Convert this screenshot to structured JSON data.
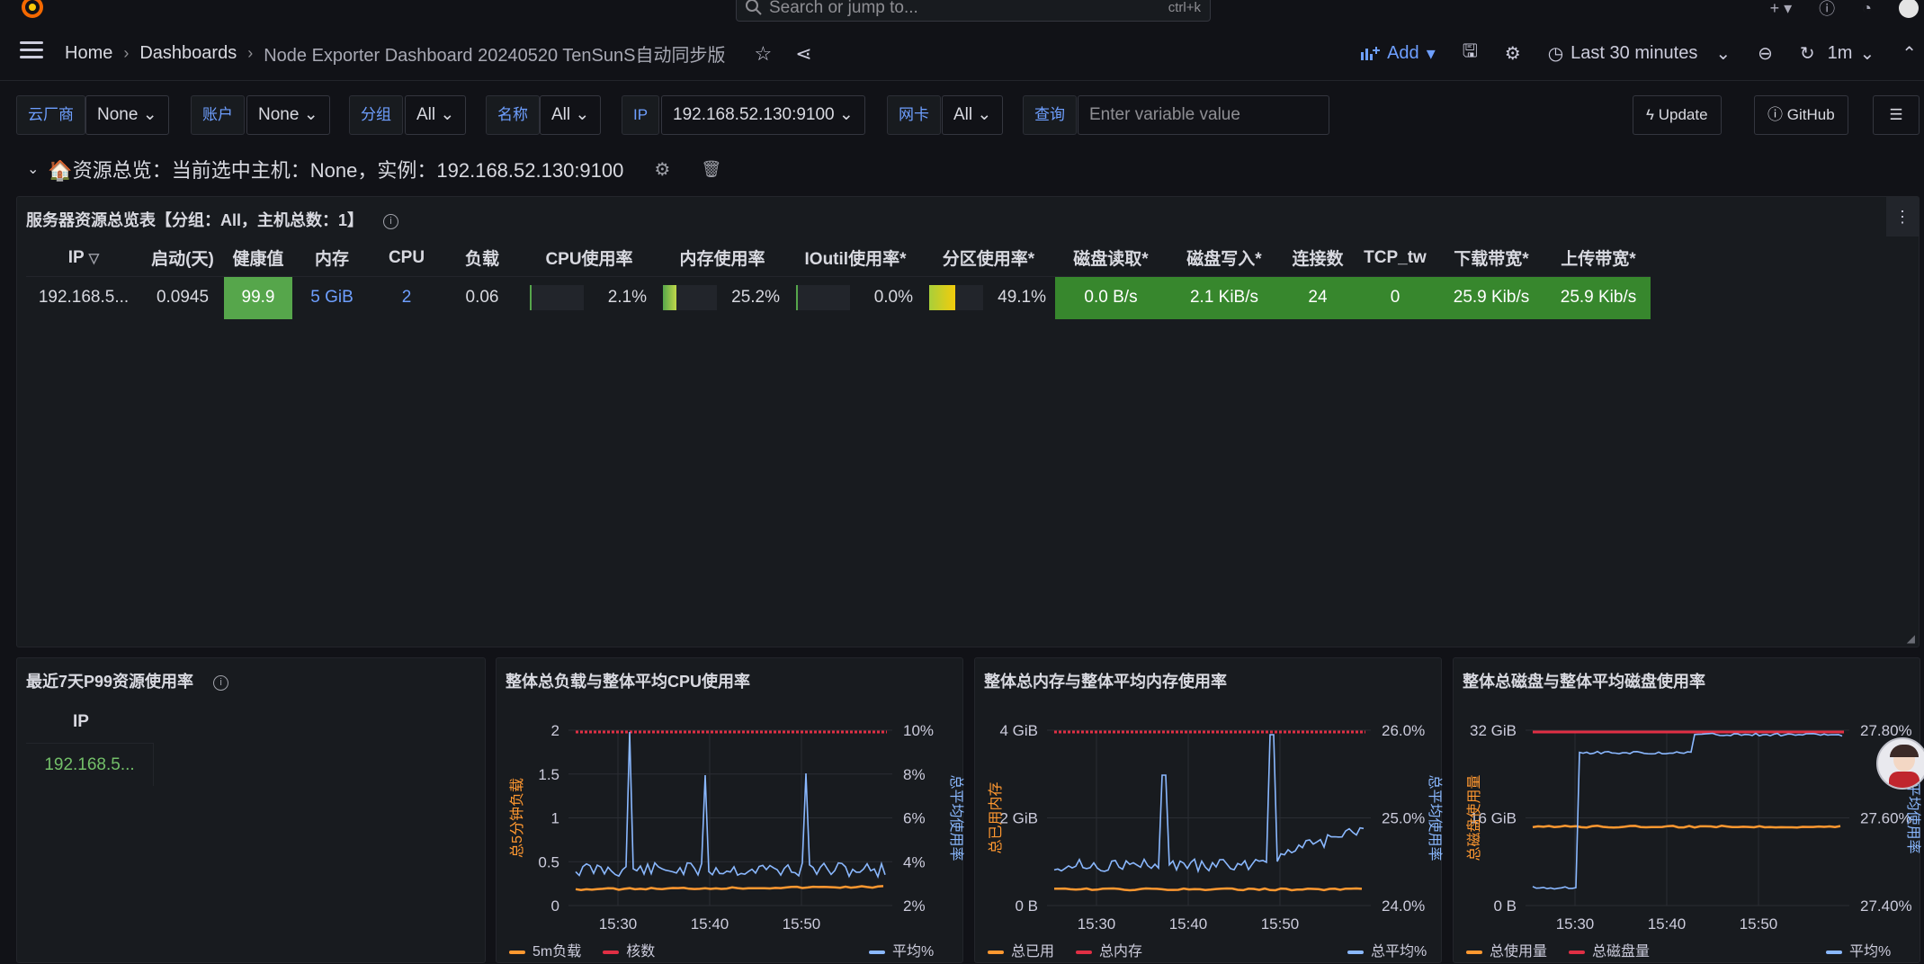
{
  "search": {
    "placeholder": "Search or jump to...",
    "shortcut": "ctrl+k"
  },
  "breadcrumb": {
    "home": "Home",
    "dashboards": "Dashboards",
    "current": "Node Exporter Dashboard 20240520 TenSunS自动同步版"
  },
  "nav": {
    "add": "Add",
    "time_range": "Last 30 minutes",
    "refresh": "1m"
  },
  "variables": [
    {
      "label": "云厂商",
      "value": "None"
    },
    {
      "label": "账户",
      "value": "None"
    },
    {
      "label": "分组",
      "value": "All"
    },
    {
      "label": "名称",
      "value": "All"
    },
    {
      "label": "IP",
      "value": "192.168.52.130:9100"
    },
    {
      "label": "网卡",
      "value": "All"
    },
    {
      "label": "查询",
      "placeholder": "Enter variable value"
    }
  ],
  "buttons": {
    "update": "Update",
    "github": "GitHub"
  },
  "row": {
    "title": "🏠资源总览：当前选中主机：None，实例：192.168.52.130:9100"
  },
  "overview_panel": {
    "title": "服务器资源总览表【分组：All，主机总数：1】",
    "headers": [
      "IP",
      "启动(天)",
      "健康值",
      "内存",
      "CPU",
      "负载",
      "CPU使用率",
      "内存使用率",
      "IOutil使用率*",
      "分区使用率*",
      "磁盘读取*",
      "磁盘写入*",
      "连接数",
      "TCP_tw",
      "下载带宽*",
      "上传带宽*"
    ],
    "row": {
      "ip": "192.168.5...",
      "uptime": "0.0945",
      "health": "99.9",
      "memory": "5 GiB",
      "cpu": "2",
      "load": "0.06",
      "cpu_usage": "2.1%",
      "mem_usage": "25.2%",
      "ioutil": "0.0%",
      "partition": "49.1%",
      "disk_read": "0.0 B/s",
      "disk_write": "2.1 KiB/s",
      "connections": "24",
      "tcp_tw": "0",
      "download": "25.9 Kib/s",
      "upload": "25.9 Kib/s"
    },
    "bars": {
      "cpu": 0.021,
      "mem": 0.252,
      "io": 0.0,
      "part": 0.491
    }
  },
  "p99_panel": {
    "title": "最近7天P99资源使用率",
    "header": "IP",
    "value": "192.168.5..."
  },
  "charts": [
    {
      "title": "整体总负载与整体平均CPU使用率",
      "left_label": "总5分钟负载",
      "right_label": "总平均使用率",
      "left_ticks": [
        "2",
        "1.5",
        "1",
        "0.5",
        "0"
      ],
      "right_ticks": [
        "10%",
        "8%",
        "6%",
        "4%",
        "2%"
      ],
      "x_ticks": [
        "15:30",
        "15:40",
        "15:50"
      ],
      "legend": [
        {
          "name": "5m负载",
          "color": "#ff9830"
        },
        {
          "name": "核数",
          "color": "#e02f44"
        },
        {
          "name": "平均%",
          "color": "#8ab8ff"
        }
      ]
    },
    {
      "title": "整体总内存与整体平均内存使用率",
      "left_label": "总已用内存",
      "right_label": "总平均使用率",
      "left_ticks": [
        "4 GiB",
        "2 GiB",
        "0 B"
      ],
      "right_ticks": [
        "26.0%",
        "25.0%",
        "24.0%"
      ],
      "x_ticks": [
        "15:30",
        "15:40",
        "15:50"
      ],
      "legend": [
        {
          "name": "总已用",
          "color": "#ff9830"
        },
        {
          "name": "总内存",
          "color": "#e02f44"
        },
        {
          "name": "总平均%",
          "color": "#8ab8ff"
        }
      ]
    },
    {
      "title": "整体总磁盘与整体平均磁盘使用率",
      "left_label": "总磁盘使用量",
      "right_label": "平均使用率",
      "left_ticks": [
        "32 GiB",
        "16 GiB",
        "0 B"
      ],
      "right_ticks": [
        "27.80%",
        "27.60%",
        "27.40%"
      ],
      "x_ticks": [
        "15:30",
        "15:40",
        "15:50"
      ],
      "legend": [
        {
          "name": "总使用量",
          "color": "#ff9830"
        },
        {
          "name": "总磁盘量",
          "color": "#e02f44"
        },
        {
          "name": "平均%",
          "color": "#8ab8ff"
        }
      ]
    }
  ]
}
